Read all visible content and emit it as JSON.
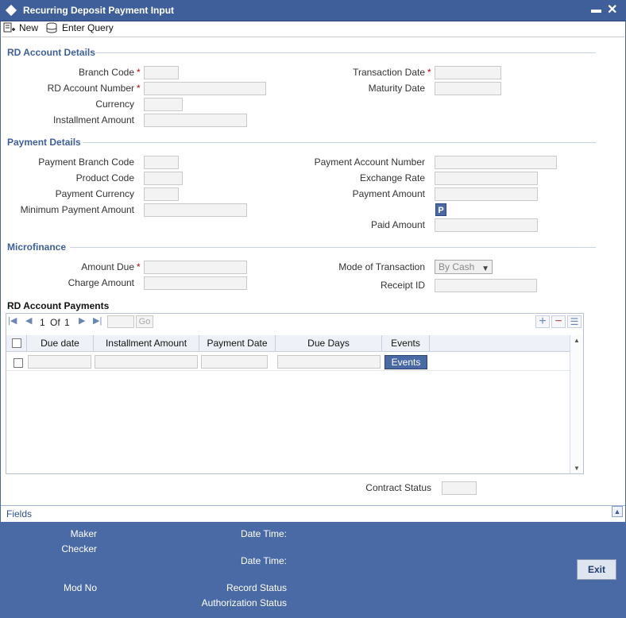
{
  "window": {
    "title": "Recurring Deposit Payment Input"
  },
  "toolbar": {
    "new_label": "New",
    "enter_query_label": "Enter Query"
  },
  "rd_account_details": {
    "heading": "RD Account Details",
    "branch_code_label": "Branch Code",
    "rd_account_number_label": "RD Account Number",
    "currency_label": "Currency",
    "installment_amount_label": "Installment Amount",
    "transaction_date_label": "Transaction Date",
    "maturity_date_label": "Maturity Date",
    "required_marker": "*"
  },
  "payment_details": {
    "heading": "Payment Details",
    "payment_branch_code_label": "Payment Branch Code",
    "product_code_label": "Product Code",
    "payment_currency_label": "Payment Currency",
    "minimum_payment_amount_label": "Minimum Payment Amount",
    "payment_account_number_label": "Payment Account Number",
    "exchange_rate_label": "Exchange Rate",
    "payment_amount_label": "Payment Amount",
    "p_button_label": "P",
    "paid_amount_label": "Paid Amount"
  },
  "microfinance": {
    "heading": "Microfinance",
    "amount_due_label": "Amount Due",
    "charge_amount_label": "Charge Amount",
    "mode_of_transaction_label": "Mode of Transaction",
    "mode_of_transaction_value": "By Cash",
    "receipt_id_label": "Receipt ID"
  },
  "rd_account_payments": {
    "heading": "RD Account Payments",
    "pager": {
      "current": "1",
      "of_label": "Of",
      "total": "1",
      "go_label": "Go"
    },
    "columns": [
      "Due date",
      "Installment Amount",
      "Payment Date",
      "Due Days",
      "Events"
    ],
    "row_button_label": "Events"
  },
  "contract_status_label": "Contract Status",
  "fields_label": "Fields",
  "footer": {
    "maker_label": "Maker",
    "checker_label": "Checker",
    "mod_no_label": "Mod No",
    "date_time_label": "Date Time:",
    "date_time_label_2": "Date Time:",
    "record_status_label": "Record Status",
    "authorization_status_label": "Authorization Status",
    "exit_label": "Exit"
  },
  "colors": {
    "title_bar": "#3f5f9a",
    "section_heading": "#3d5f9b",
    "footer_bg": "#4a6aa5",
    "required": "#c00000"
  }
}
